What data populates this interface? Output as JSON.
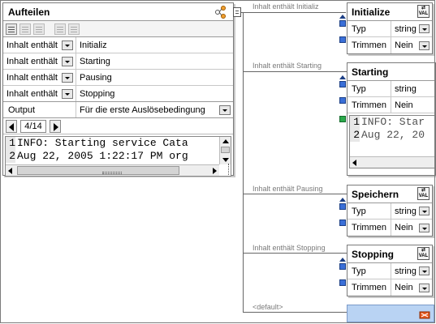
{
  "main": {
    "title": "Aufteilen",
    "conditions": [
      {
        "op": "Inhalt enthält",
        "value": "Initializ"
      },
      {
        "op": "Inhalt enthält",
        "value": "Starting"
      },
      {
        "op": "Inhalt enthält",
        "value": "Pausing"
      },
      {
        "op": "Inhalt enthält",
        "value": "Stopping"
      }
    ],
    "output_label": "Output",
    "output_value": "Für die erste Auslösebedingung",
    "nav_count": "4/14",
    "text_lines": [
      {
        "num": "1",
        "text": "INFO: Starting service Cata"
      },
      {
        "num": "2",
        "text": "Aug 22, 2005 1:22:17 PM org"
      }
    ]
  },
  "connectors": {
    "initializ": "Inhalt enthält Initializ",
    "starting": "Inhalt enthält Starting",
    "pausing": "Inhalt enthält Pausing",
    "stopping": "Inhalt enthält Stopping",
    "default": "<default>"
  },
  "initialize": {
    "title": "Initialize",
    "icon_text": "VAL",
    "rows": [
      {
        "label": "Typ",
        "value": "string"
      },
      {
        "label": "Trimmen",
        "value": "Nein"
      }
    ]
  },
  "starting": {
    "title": "Starting",
    "rows": [
      {
        "label": "Typ",
        "value": "string"
      },
      {
        "label": "Trimmen",
        "value": "Nein"
      }
    ],
    "text_lines": [
      {
        "num": "1",
        "text": "INFO: Star"
      },
      {
        "num": "2",
        "text": "Aug 22, 20"
      }
    ]
  },
  "speichern": {
    "title": "Speichern",
    "icon_text": "VAL",
    "rows": [
      {
        "label": "Typ",
        "value": "string"
      },
      {
        "label": "Trimmen",
        "value": "Nein"
      }
    ]
  },
  "stopping": {
    "title": "Stopping",
    "icon_text": "VAL",
    "rows": [
      {
        "label": "Typ",
        "value": "string"
      },
      {
        "label": "Trimmen",
        "value": "Nein"
      }
    ]
  },
  "colors": {
    "port_blue": "#3a6fd8",
    "port_green": "#2aa84a",
    "default_fill": "#b9d3f3",
    "connector_label": "#7a7a7a"
  }
}
